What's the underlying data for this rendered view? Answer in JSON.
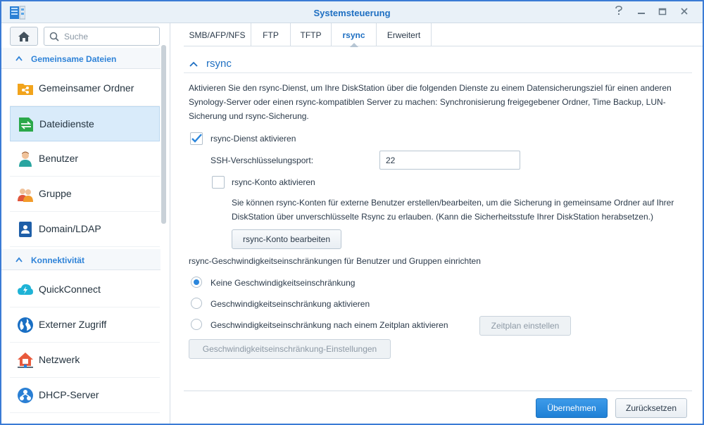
{
  "window": {
    "title": "Systemsteuerung",
    "controls": [
      "help-icon",
      "minimize-icon",
      "maximize-icon",
      "close-icon"
    ]
  },
  "sidebar": {
    "search_placeholder": "Suche",
    "groups": [
      {
        "label": "Gemeinsame Dateien"
      },
      {
        "label": "Konnektivität"
      }
    ],
    "items": [
      {
        "label": "Gemeinsamer Ordner",
        "icon": "shared-folder-icon"
      },
      {
        "label": "Dateidienste",
        "icon": "file-services-icon",
        "active": true
      },
      {
        "label": "Benutzer",
        "icon": "user-icon"
      },
      {
        "label": "Gruppe",
        "icon": "group-icon"
      },
      {
        "label": "Domain/LDAP",
        "icon": "domain-ldap-icon"
      },
      {
        "label": "QuickConnect",
        "icon": "quickconnect-icon"
      },
      {
        "label": "Externer Zugriff",
        "icon": "external-access-icon"
      },
      {
        "label": "Netzwerk",
        "icon": "network-icon"
      },
      {
        "label": "DHCP-Server",
        "icon": "dhcp-server-icon"
      }
    ]
  },
  "tabs": [
    {
      "label": "SMB/AFP/NFS"
    },
    {
      "label": "FTP"
    },
    {
      "label": "TFTP"
    },
    {
      "label": "rsync",
      "active": true
    },
    {
      "label": "Erweitert"
    }
  ],
  "section": {
    "title": "rsync",
    "description": "Aktivieren Sie den rsync-Dienst, um Ihre DiskStation über die folgenden Dienste zu einem Datensicherungsziel für einen anderen Synology-Server oder einen rsync-kompatiblen Server zu machen: Synchronisierung freigegebener Ordner, Time Backup, LUN-Sicherung und rsync-Sicherung.",
    "enable_rsync": {
      "label": "rsync-Dienst aktivieren",
      "checked": true
    },
    "ssh_port": {
      "label": "SSH-Verschlüsselungsport:",
      "value": "22"
    },
    "enable_account": {
      "label": "rsync-Konto aktivieren",
      "checked": false
    },
    "account_note": "Sie können rsync-Konten für externe Benutzer erstellen/bearbeiten, um die Sicherung in gemeinsame Ordner auf Ihrer DiskStation über unverschlüsselte Rsync zu erlauben. (Kann die Sicherheitsstufe Ihrer DiskStation herabsetzen.)",
    "edit_account_button": "rsync-Konto bearbeiten",
    "speed_limit_heading": "rsync-Geschwindigkeitseinschränkungen für Benutzer und Gruppen einrichten",
    "speed_options": [
      {
        "label": "Keine Geschwindigkeitseinschränkung",
        "selected": true
      },
      {
        "label": "Geschwindigkeitseinschränkung aktivieren",
        "selected": false
      },
      {
        "label": "Geschwindigkeitseinschränkung nach einem Zeitplan aktivieren",
        "selected": false
      }
    ],
    "schedule_button": "Zeitplan einstellen",
    "speed_settings_button": "Geschwindigkeitseinschränkung-Einstellungen"
  },
  "footer": {
    "apply_button": "Übernehmen",
    "reset_button": "Zurücksetzen"
  },
  "colors": {
    "accent": "#1e6fc2",
    "active_item": "#d9ebfa",
    "primary_button": "#2b86dc"
  }
}
